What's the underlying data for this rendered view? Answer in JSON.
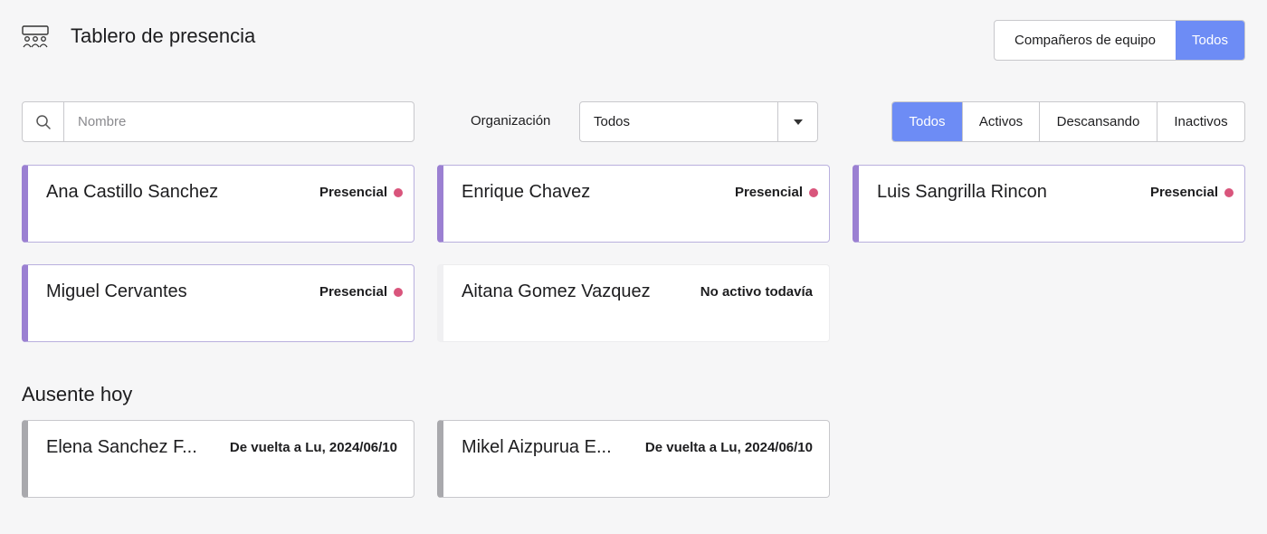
{
  "header": {
    "title": "Tablero de presencia",
    "icon": "team-icon",
    "scope_toggle": {
      "team_label": "Compañeros de equipo",
      "all_label": "Todos",
      "selected": "Todos"
    }
  },
  "filters": {
    "search_placeholder": "Nombre",
    "search_value": "",
    "org_label": "Organización",
    "org_value": "Todos",
    "status_options": [
      {
        "label": "Todos",
        "active": true
      },
      {
        "label": "Activos",
        "active": false
      },
      {
        "label": "Descansando",
        "active": false
      },
      {
        "label": "Inactivos",
        "active": false
      }
    ]
  },
  "present": [
    {
      "name": "Ana Castillo Sanchez",
      "status": "Presencial"
    },
    {
      "name": "Enrique Chavez",
      "status": "Presencial"
    },
    {
      "name": "Luis Sangrilla Rincon",
      "status": "Presencial"
    },
    {
      "name": "Miguel Cervantes",
      "status": "Presencial"
    },
    {
      "name": "Aitana Gomez Vazquez",
      "status": "No activo todavía"
    }
  ],
  "absent_section": {
    "title": "Ausente hoy",
    "people": [
      {
        "name": "Elena Sanchez F...",
        "status": "De vuelta a Lu, 2024/06/10"
      },
      {
        "name": "Mikel Aizpurua E...",
        "status": "De vuelta a Lu, 2024/06/10"
      }
    ]
  },
  "colors": {
    "accent": "#6d8cf5",
    "present_bar": "#9b80d2",
    "absent_bar": "#a9a9ad",
    "status_dot": "#d9557c"
  }
}
